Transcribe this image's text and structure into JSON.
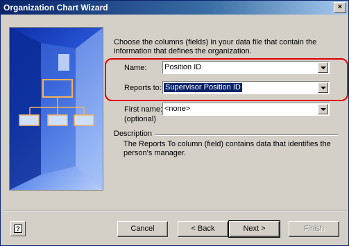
{
  "window": {
    "title": "Organization Chart Wizard",
    "close_glyph": "×"
  },
  "intro_text": "Choose the columns (fields) in your data file that contain the information that defines the organization.",
  "fields": {
    "name": {
      "label": "Name:",
      "value": "Position ID",
      "icon": "chevron-down-icon"
    },
    "reports_to": {
      "label": "Reports to:",
      "value": "Supervisor Position ID",
      "icon": "chevron-down-icon"
    },
    "first_name": {
      "label": "First name:",
      "sublabel": "(optional)",
      "value": "<none>",
      "icon": "chevron-down-icon"
    }
  },
  "description": {
    "heading": "Description",
    "text": "The Reports To column (field) contains data that identifies the person's manager."
  },
  "buttons": {
    "help_glyph": "?",
    "cancel": "Cancel",
    "back": "< Back",
    "next": "Next >",
    "finish": "Finish"
  },
  "colors": {
    "highlight": "#e00000",
    "selection": "#0a246a",
    "title_bar": "#0a246a"
  }
}
